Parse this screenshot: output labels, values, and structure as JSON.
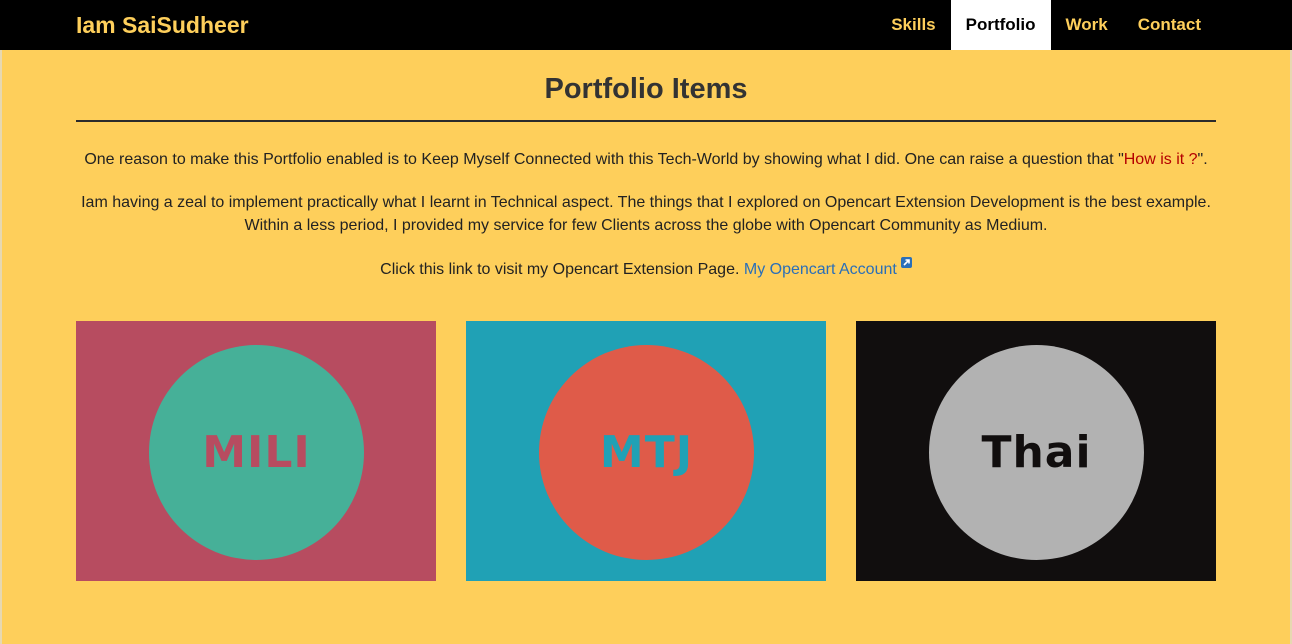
{
  "nav": {
    "brand": "Iam SaiSudheer",
    "items": [
      {
        "label": "Skills",
        "active": false
      },
      {
        "label": "Portfolio",
        "active": true
      },
      {
        "label": "Work",
        "active": false
      },
      {
        "label": "Contact",
        "active": false
      }
    ]
  },
  "main": {
    "title": "Portfolio Items",
    "para1": {
      "text": "One reason to make this Portfolio enabled is to Keep Myself Connected with this Tech-World by showing what I did. One can raise a question that \"",
      "highlight": "How is it ?",
      "end": "\"."
    },
    "para2": "Iam having a zeal to implement practically what I learnt in Technical aspect. The things that I explored on Opencart Extension Development is the best example. Within a less period, I provided my service for few Clients across the globe with Opencart Community as Medium.",
    "para3": {
      "text": "Click this link to visit my Opencart Extension Page. ",
      "link": "My Opencart Account",
      "link_icon": "external-link-icon"
    }
  },
  "portfolio": [
    {
      "label": "MILI",
      "bg": "#b74c60",
      "circle": "#46b098",
      "text_color": "#b74c60"
    },
    {
      "label": "MTJ",
      "bg": "#20a1b5",
      "circle": "#df5b49",
      "text_color": "#20a1b5"
    },
    {
      "label": "Thai",
      "bg": "#110e0e",
      "circle": "#b2b2b2",
      "text_color": "#110e0e"
    }
  ],
  "colors": {
    "background": "#fecf5b",
    "navbar": "#000000",
    "brand": "#fecf5b",
    "active_tab": "#ffffff",
    "link": "#2a6fb8",
    "highlight": "#b40000"
  }
}
